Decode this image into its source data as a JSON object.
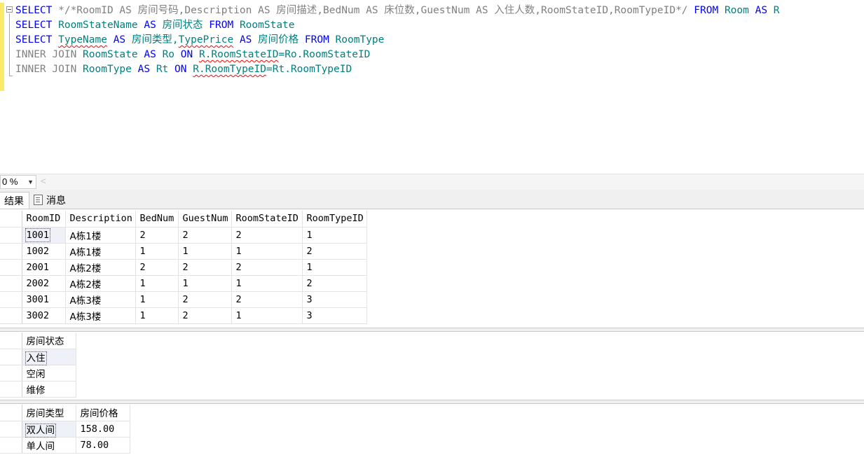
{
  "editor": {
    "line1": {
      "kw1": "SELECT",
      "comment": " */*RoomID AS 房间号码,Description AS 房间描述,BedNum AS 床位数,GuestNum AS 入住人数,RoomStateID,RoomTypeID*/ ",
      "kw2": "FROM",
      "sp": " ",
      "tbl": "Room",
      "sp2": " ",
      "kw3": "AS",
      "alias": " R"
    },
    "line2": {
      "kw1": "SELECT",
      "col": "RoomStateName",
      "kw2": "AS",
      "alias": "房间状态",
      "kw3": "FROM",
      "tbl": "RoomState"
    },
    "line3": {
      "kw1": "SELECT",
      "col1": "TypeName",
      "kw2": "AS",
      "alias1": "房间类型,",
      "col2": "TypePrice",
      "kw3": "AS",
      "alias2": "房间价格",
      "kw4": "FROM",
      "tbl": "RoomType"
    },
    "line4": {
      "kw": "INNER JOIN",
      "tbl": "RoomState",
      "as": "AS",
      "alias": "Ro",
      "on": "ON",
      "left": "R.RoomStateID",
      "right": "=Ro.RoomStateID"
    },
    "line5": {
      "kw": "INNER JOIN",
      "tbl": "RoomType",
      "as": "AS",
      "alias": "Rt",
      "on": "ON",
      "left": "R.RoomTypeID",
      "right": "=Rt.RoomTypeID"
    }
  },
  "toolbar": {
    "zoom": "0 %",
    "scroll_left": "<"
  },
  "tabs": {
    "results": "结果",
    "messages": "消息"
  },
  "grid1": {
    "headers": [
      "RoomID",
      "Description",
      "BedNum",
      "GuestNum",
      "RoomStateID",
      "RoomTypeID"
    ],
    "rows": [
      [
        "1001",
        "A栋1楼",
        "2",
        "2",
        "2",
        "1"
      ],
      [
        "1002",
        "A栋1楼",
        "1",
        "1",
        "1",
        "2"
      ],
      [
        "2001",
        "A栋2楼",
        "2",
        "2",
        "2",
        "1"
      ],
      [
        "2002",
        "A栋2楼",
        "1",
        "1",
        "1",
        "2"
      ],
      [
        "3001",
        "A栋3楼",
        "1",
        "2",
        "2",
        "3"
      ],
      [
        "3002",
        "A栋3楼",
        "1",
        "2",
        "1",
        "3"
      ]
    ]
  },
  "grid2": {
    "headers": [
      "房间状态"
    ],
    "rows": [
      [
        "入住"
      ],
      [
        "空闲"
      ],
      [
        "维修"
      ]
    ]
  },
  "grid3": {
    "headers": [
      "房间类型",
      "房间价格"
    ],
    "rows": [
      [
        "双人间",
        "158.00"
      ],
      [
        "单人间",
        "78.00"
      ]
    ]
  },
  "colors": {
    "keyword": "#0000ff",
    "identifier": "#008080",
    "join_gray": "#808080",
    "change_bar": "#fce96a"
  }
}
